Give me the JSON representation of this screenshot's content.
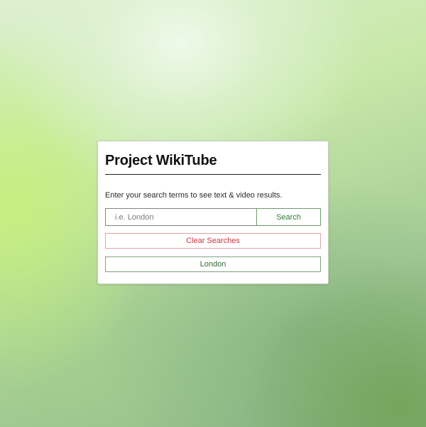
{
  "app": {
    "title": "Project WikiTube",
    "intro": "Enter your search terms to see text & video results."
  },
  "search": {
    "placeholder": "i.e. London",
    "value": "",
    "button_label": "Search"
  },
  "actions": {
    "clear_label": "Clear Searches"
  },
  "history": {
    "items": [
      {
        "label": "London"
      }
    ]
  },
  "colors": {
    "accent_green": "#2f7a2f",
    "danger_red": "#d0343f"
  }
}
